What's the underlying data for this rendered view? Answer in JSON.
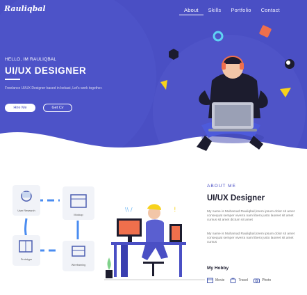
{
  "header": {
    "logo": "Rauliqbal",
    "nav": [
      {
        "label": "About",
        "active": true
      },
      {
        "label": "Skills",
        "active": false
      },
      {
        "label": "Portfolio",
        "active": false
      },
      {
        "label": "Contact",
        "active": false
      }
    ]
  },
  "hero": {
    "greeting": "HELLO, IM RAULIQBAL",
    "role": "UI/UX DESIGNER",
    "intro": "Freelance UI/UX Designer based in bekasi, Let's work together.",
    "hire_button": "Hire Me",
    "cv_button": "Get Cv"
  },
  "process": {
    "steps": [
      {
        "label": "User Research",
        "icon": "user-research-icon"
      },
      {
        "label": "Mockup",
        "icon": "mockup-icon"
      },
      {
        "label": "Prototype",
        "icon": "prototype-icon"
      },
      {
        "label": "Wireframing",
        "icon": "wireframing-icon"
      }
    ]
  },
  "about": {
    "label": "ABOUT ME",
    "title": "UI/UX Designer",
    "paragraph1": "My name is Muhamad Rauliqbal,lorem ipsum dolor sit amet consequat semper viverra nam libero justo laoreet sit amet cursus sit amet dictum sit amet",
    "paragraph2": "My name is Muhamad Rauliqbal,lorem ipsum dolor sit amet consequat semper viverra nam libero justo laoreet sit amet cursus",
    "hobby_title": "My Hobby",
    "hobbies": [
      {
        "label": "Movie",
        "icon": "movie-icon"
      },
      {
        "label": "Travel",
        "icon": "travel-icon"
      },
      {
        "label": "Photo",
        "icon": "camera-icon"
      }
    ]
  },
  "colors": {
    "primary": "#4a4fc4",
    "accent_yellow": "#f7d21c",
    "accent_orange": "#ef6f4c",
    "dark": "#1c1c2e"
  }
}
